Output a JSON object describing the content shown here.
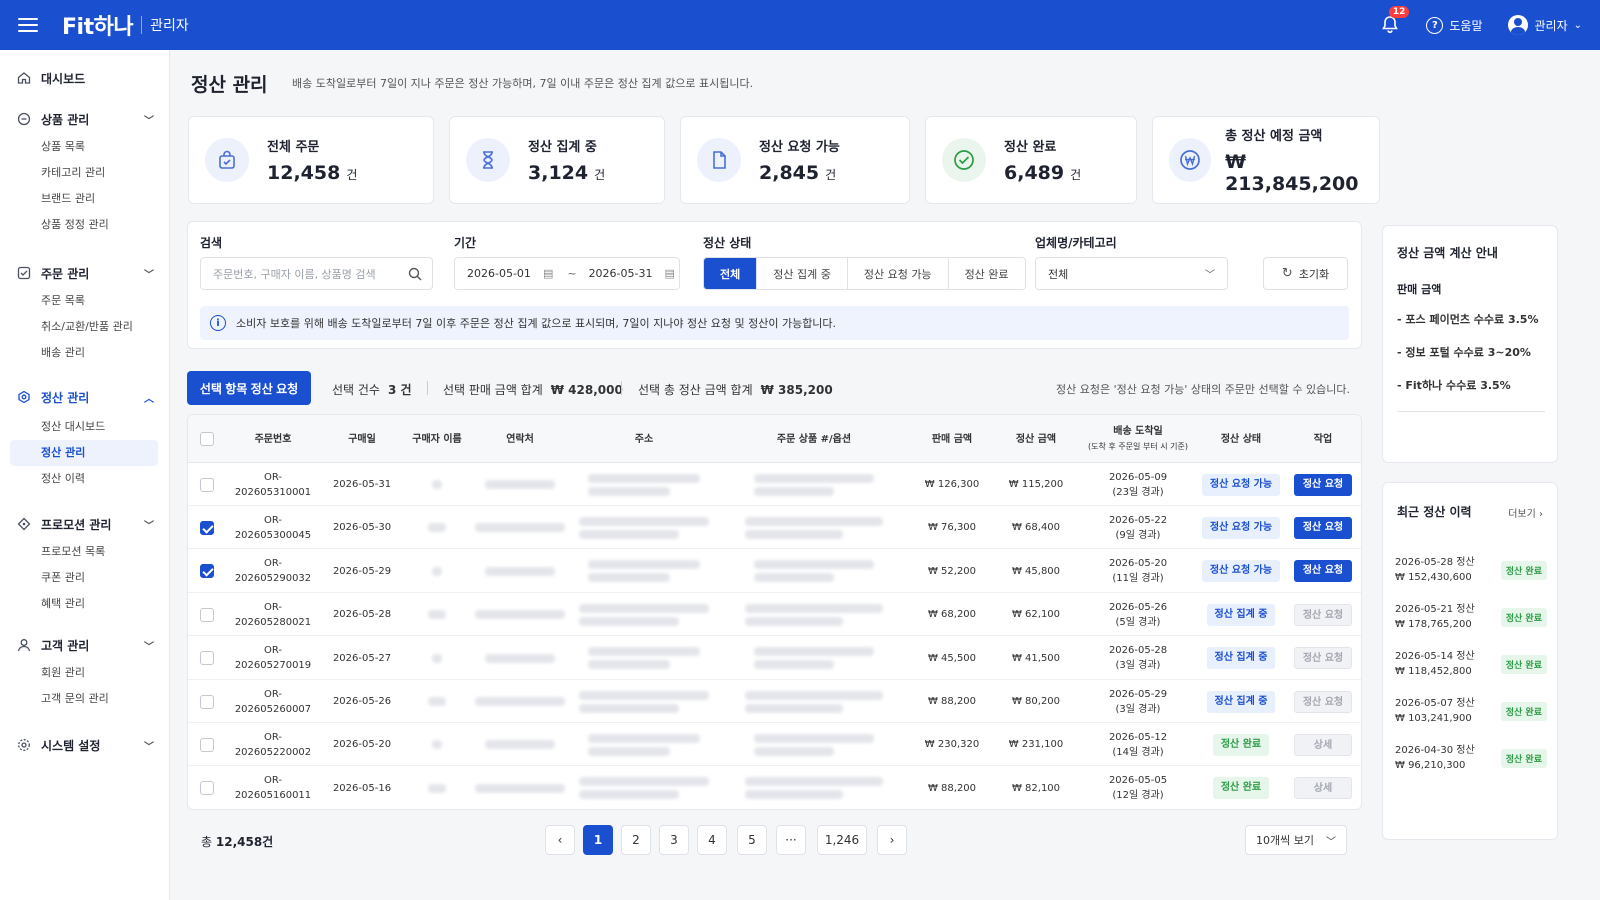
{
  "app": {
    "logo": "Fit하나",
    "admin_label": "관리자",
    "notif_count": "12",
    "help_label": "도움말",
    "user_label": "관리자"
  },
  "sidebar": {
    "dashboard": "대시보드",
    "groups": [
      {
        "label": "상품 관리",
        "items": [
          "상품 목록",
          "카테고리 관리",
          "브랜드 관리",
          "상품 정정 관리"
        ]
      },
      {
        "label": "주문 관리",
        "items": [
          "주문 목록",
          "취소/교환/반품 관리",
          "배송 관리"
        ]
      },
      {
        "label": "정산 관리",
        "items": [
          "정산 대시보드",
          "정산 관리",
          "정산 이력"
        ]
      },
      {
        "label": "프로모션 관리",
        "items": [
          "프로모션 목록",
          "쿠폰 관리",
          "혜택 관리"
        ]
      },
      {
        "label": "고객 관리",
        "items": [
          "회원 관리",
          "고객 문의 관리"
        ]
      }
    ],
    "system": "시스템 설정"
  },
  "page": {
    "title": "정산 관리",
    "desc": "배송 도착일로부터 7일이 지나 주문은 정산 가능하며, 7일 이내 주문은 정산 집계 값으로 표시됩니다."
  },
  "stats": [
    {
      "label": "전체 주문",
      "value": "12,458",
      "unit": "건",
      "color": "#4a6fd8"
    },
    {
      "label": "정산 집계 중",
      "value": "3,124",
      "unit": "건",
      "color": "#4a6fd8"
    },
    {
      "label": "정산 요청 가능",
      "value": "2,845",
      "unit": "건",
      "color": "#4a6fd8"
    },
    {
      "label": "정산 완료",
      "value": "6,489",
      "unit": "건",
      "color": "#2e9c48"
    },
    {
      "label": "총 정산 예정 금액",
      "value": "₩ 213,845,200",
      "unit": "",
      "color": "#4a6fd8"
    }
  ],
  "filter": {
    "search_label": "검색",
    "search_placeholder": "주문번호, 구매자 이름, 상품명 검색",
    "period_label": "기간",
    "date_from": "2026-05-01",
    "date_sep": "~",
    "date_to": "2026-05-31",
    "status_label": "정산 상태",
    "status_options": [
      "전체",
      "정산 집계 중",
      "정산 요청 가능",
      "정산 완료"
    ],
    "vendor_label": "업체명/카테고리",
    "vendor_value": "전체",
    "reset_label": "초기화",
    "notice": "소비자 보호를 위해 배송 도착일로부터 7일 이후 주문은 정산 집계 값으로 표시되며, 7일이 지나야 정산 요청 및 정산이 가능합니다."
  },
  "toolbar": {
    "request_btn": "선택 항목 정산 요청",
    "sel_count_label": "선택 건수",
    "sel_count": "3 건",
    "sel_sales_label": "선택 판매 금액 합계",
    "sel_sales": "₩ 428,000",
    "sel_settle_label": "선택 총 정산 금액 합계",
    "sel_settle": "₩ 385,200",
    "hint": "정산 요청은 '정산 요청 가능' 상태의 주문만 선택할 수 있습니다."
  },
  "table": {
    "headers": {
      "order_no": "주문번호",
      "buy_date": "구매일",
      "buyer": "구매자 이름",
      "contact": "연락처",
      "address": "주소",
      "product": "주문 상품 #/옵션",
      "sales": "판매 금액",
      "settle": "정산 금액",
      "arrival": "배송 도착일",
      "arrival_sub": "(도착 후 주문일 부터 시 기준)",
      "status": "정산 상태",
      "action": "작업"
    },
    "rows": [
      {
        "checked": false,
        "order_no": "OR-202605310001",
        "buy_date": "2026-05-31",
        "sales": "₩ 126,300",
        "settle": "₩ 115,200",
        "arrival": "2026-05-09",
        "elapsed": "(23일 경과)",
        "status": "정산 요청 가능",
        "status_kind": "ok",
        "action": "정산 요청",
        "action_kind": "on"
      },
      {
        "checked": true,
        "order_no": "OR-202605300045",
        "buy_date": "2026-05-30",
        "sales": "₩ 76,300",
        "settle": "₩ 68,400",
        "arrival": "2026-05-22",
        "elapsed": "(9일 경과)",
        "status": "정산 요청 가능",
        "status_kind": "ok",
        "action": "정산 요청",
        "action_kind": "on"
      },
      {
        "checked": true,
        "order_no": "OR-202605290032",
        "buy_date": "2026-05-29",
        "sales": "₩ 52,200",
        "settle": "₩ 45,800",
        "arrival": "2026-05-20",
        "elapsed": "(11일 경과)",
        "status": "정산 요청 가능",
        "status_kind": "ok",
        "action": "정산 요청",
        "action_kind": "on"
      },
      {
        "checked": false,
        "order_no": "OR-202605280021",
        "buy_date": "2026-05-28",
        "sales": "₩ 68,200",
        "settle": "₩ 62,100",
        "arrival": "2026-05-26",
        "elapsed": "(5일 경과)",
        "status": "정산 집계 중",
        "status_kind": "agg",
        "action": "정산 요청",
        "action_kind": "off"
      },
      {
        "checked": false,
        "order_no": "OR-202605270019",
        "buy_date": "2026-05-27",
        "sales": "₩ 45,500",
        "settle": "₩ 41,500",
        "arrival": "2026-05-28",
        "elapsed": "(3일 경과)",
        "status": "정산 집계 중",
        "status_kind": "agg",
        "action": "정산 요청",
        "action_kind": "off"
      },
      {
        "checked": false,
        "order_no": "OR-202605260007",
        "buy_date": "2026-05-26",
        "sales": "₩ 88,200",
        "settle": "₩ 80,200",
        "arrival": "2026-05-29",
        "elapsed": "(3일 경과)",
        "status": "정산 집계 중",
        "status_kind": "agg",
        "action": "정산 요청",
        "action_kind": "off"
      },
      {
        "checked": false,
        "order_no": "OR-202605220002",
        "buy_date": "2026-05-20",
        "sales": "₩ 230,320",
        "settle": "₩ 231,100",
        "arrival": "2026-05-12",
        "elapsed": "(14일 경과)",
        "status": "정산 완료",
        "status_kind": "done",
        "action": "상세",
        "action_kind": "off"
      },
      {
        "checked": false,
        "order_no": "OR-202605160011",
        "buy_date": "2026-05-16",
        "sales": "₩ 88,200",
        "settle": "₩ 82,100",
        "arrival": "2026-05-05",
        "elapsed": "(12일 경과)",
        "status": "정산 완료",
        "status_kind": "done",
        "action": "상세",
        "action_kind": "off"
      }
    ]
  },
  "pager": {
    "total_prefix": "총",
    "total": "12,458건",
    "pages": [
      "1",
      "2",
      "3",
      "4",
      "5",
      "···",
      "1,246"
    ],
    "page_size": "10개씩 보기"
  },
  "fee_panel": {
    "title": "정산 금액 계산 안내",
    "subtitle": "판매 금액",
    "lines": [
      "- 포스 페이먼츠 수수료 3.5%",
      "- 정보 포털 수수료 3~20%",
      "- Fit하나 수수료 3.5%"
    ]
  },
  "history": {
    "title": "최근 정산 이력",
    "more": "더보기",
    "items": [
      {
        "date": "2026-05-28 정산",
        "amount": "₩ 152,430,600",
        "status": "정산 완료"
      },
      {
        "date": "2026-05-21 정산",
        "amount": "₩ 178,765,200",
        "status": "정산 완료"
      },
      {
        "date": "2026-05-14 정산",
        "amount": "₩ 118,452,800",
        "status": "정산 완료"
      },
      {
        "date": "2026-05-07 정산",
        "amount": "₩ 103,241,900",
        "status": "정산 완료"
      },
      {
        "date": "2026-04-30 정산",
        "amount": "₩ 96,210,300",
        "status": "정산 완료"
      }
    ]
  }
}
